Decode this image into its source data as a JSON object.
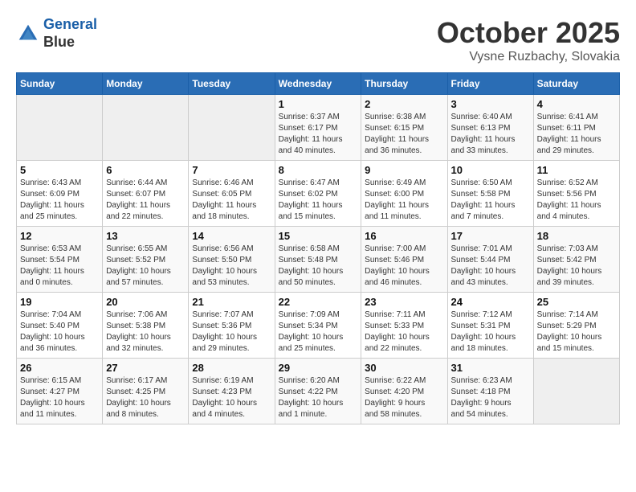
{
  "header": {
    "logo_line1": "General",
    "logo_line2": "Blue",
    "month": "October 2025",
    "location": "Vysne Ruzbachy, Slovakia"
  },
  "days_of_week": [
    "Sunday",
    "Monday",
    "Tuesday",
    "Wednesday",
    "Thursday",
    "Friday",
    "Saturday"
  ],
  "weeks": [
    [
      {
        "day": "",
        "info": ""
      },
      {
        "day": "",
        "info": ""
      },
      {
        "day": "",
        "info": ""
      },
      {
        "day": "1",
        "info": "Sunrise: 6:37 AM\nSunset: 6:17 PM\nDaylight: 11 hours\nand 40 minutes."
      },
      {
        "day": "2",
        "info": "Sunrise: 6:38 AM\nSunset: 6:15 PM\nDaylight: 11 hours\nand 36 minutes."
      },
      {
        "day": "3",
        "info": "Sunrise: 6:40 AM\nSunset: 6:13 PM\nDaylight: 11 hours\nand 33 minutes."
      },
      {
        "day": "4",
        "info": "Sunrise: 6:41 AM\nSunset: 6:11 PM\nDaylight: 11 hours\nand 29 minutes."
      }
    ],
    [
      {
        "day": "5",
        "info": "Sunrise: 6:43 AM\nSunset: 6:09 PM\nDaylight: 11 hours\nand 25 minutes."
      },
      {
        "day": "6",
        "info": "Sunrise: 6:44 AM\nSunset: 6:07 PM\nDaylight: 11 hours\nand 22 minutes."
      },
      {
        "day": "7",
        "info": "Sunrise: 6:46 AM\nSunset: 6:05 PM\nDaylight: 11 hours\nand 18 minutes."
      },
      {
        "day": "8",
        "info": "Sunrise: 6:47 AM\nSunset: 6:02 PM\nDaylight: 11 hours\nand 15 minutes."
      },
      {
        "day": "9",
        "info": "Sunrise: 6:49 AM\nSunset: 6:00 PM\nDaylight: 11 hours\nand 11 minutes."
      },
      {
        "day": "10",
        "info": "Sunrise: 6:50 AM\nSunset: 5:58 PM\nDaylight: 11 hours\nand 7 minutes."
      },
      {
        "day": "11",
        "info": "Sunrise: 6:52 AM\nSunset: 5:56 PM\nDaylight: 11 hours\nand 4 minutes."
      }
    ],
    [
      {
        "day": "12",
        "info": "Sunrise: 6:53 AM\nSunset: 5:54 PM\nDaylight: 11 hours\nand 0 minutes."
      },
      {
        "day": "13",
        "info": "Sunrise: 6:55 AM\nSunset: 5:52 PM\nDaylight: 10 hours\nand 57 minutes."
      },
      {
        "day": "14",
        "info": "Sunrise: 6:56 AM\nSunset: 5:50 PM\nDaylight: 10 hours\nand 53 minutes."
      },
      {
        "day": "15",
        "info": "Sunrise: 6:58 AM\nSunset: 5:48 PM\nDaylight: 10 hours\nand 50 minutes."
      },
      {
        "day": "16",
        "info": "Sunrise: 7:00 AM\nSunset: 5:46 PM\nDaylight: 10 hours\nand 46 minutes."
      },
      {
        "day": "17",
        "info": "Sunrise: 7:01 AM\nSunset: 5:44 PM\nDaylight: 10 hours\nand 43 minutes."
      },
      {
        "day": "18",
        "info": "Sunrise: 7:03 AM\nSunset: 5:42 PM\nDaylight: 10 hours\nand 39 minutes."
      }
    ],
    [
      {
        "day": "19",
        "info": "Sunrise: 7:04 AM\nSunset: 5:40 PM\nDaylight: 10 hours\nand 36 minutes."
      },
      {
        "day": "20",
        "info": "Sunrise: 7:06 AM\nSunset: 5:38 PM\nDaylight: 10 hours\nand 32 minutes."
      },
      {
        "day": "21",
        "info": "Sunrise: 7:07 AM\nSunset: 5:36 PM\nDaylight: 10 hours\nand 29 minutes."
      },
      {
        "day": "22",
        "info": "Sunrise: 7:09 AM\nSunset: 5:34 PM\nDaylight: 10 hours\nand 25 minutes."
      },
      {
        "day": "23",
        "info": "Sunrise: 7:11 AM\nSunset: 5:33 PM\nDaylight: 10 hours\nand 22 minutes."
      },
      {
        "day": "24",
        "info": "Sunrise: 7:12 AM\nSunset: 5:31 PM\nDaylight: 10 hours\nand 18 minutes."
      },
      {
        "day": "25",
        "info": "Sunrise: 7:14 AM\nSunset: 5:29 PM\nDaylight: 10 hours\nand 15 minutes."
      }
    ],
    [
      {
        "day": "26",
        "info": "Sunrise: 6:15 AM\nSunset: 4:27 PM\nDaylight: 10 hours\nand 11 minutes."
      },
      {
        "day": "27",
        "info": "Sunrise: 6:17 AM\nSunset: 4:25 PM\nDaylight: 10 hours\nand 8 minutes."
      },
      {
        "day": "28",
        "info": "Sunrise: 6:19 AM\nSunset: 4:23 PM\nDaylight: 10 hours\nand 4 minutes."
      },
      {
        "day": "29",
        "info": "Sunrise: 6:20 AM\nSunset: 4:22 PM\nDaylight: 10 hours\nand 1 minute."
      },
      {
        "day": "30",
        "info": "Sunrise: 6:22 AM\nSunset: 4:20 PM\nDaylight: 9 hours\nand 58 minutes."
      },
      {
        "day": "31",
        "info": "Sunrise: 6:23 AM\nSunset: 4:18 PM\nDaylight: 9 hours\nand 54 minutes."
      },
      {
        "day": "",
        "info": ""
      }
    ]
  ]
}
